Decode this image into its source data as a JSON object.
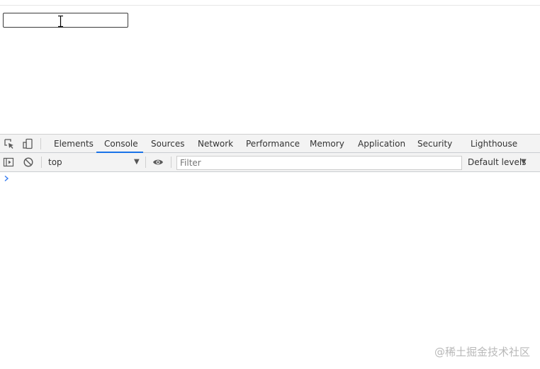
{
  "page": {
    "input_value": "",
    "input_placeholder": ""
  },
  "devtools": {
    "icons": {
      "inspect": "inspect-element-icon",
      "device": "device-toolbar-icon",
      "sidebar": "show-console-sidebar-icon",
      "clear": "clear-console-icon",
      "eye": "live-expression-eye-icon",
      "prompt": "console-prompt-chevron-icon"
    },
    "tabs": [
      {
        "label": "Elements"
      },
      {
        "label": "Console",
        "active": true
      },
      {
        "label": "Sources"
      },
      {
        "label": "Network"
      },
      {
        "label": "Performance"
      },
      {
        "label": "Memory"
      },
      {
        "label": "Application"
      },
      {
        "label": "Security"
      },
      {
        "label": "Lighthouse"
      }
    ],
    "toolbar": {
      "context": "top",
      "filter_placeholder": "Filter",
      "filter_value": "",
      "levels": "Default levels"
    },
    "accent_color": "#1a73e8"
  },
  "watermark": "@稀土掘金技术社区"
}
